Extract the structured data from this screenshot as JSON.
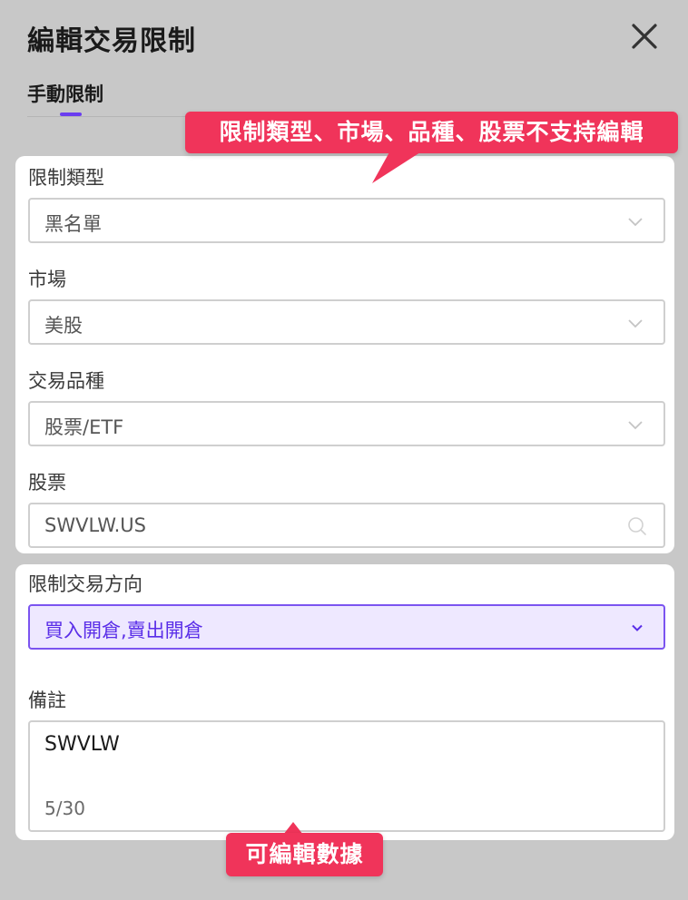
{
  "dialog": {
    "title": "編輯交易限制",
    "close_icon": "close-icon"
  },
  "tabs": [
    {
      "label": "手動限制",
      "active": true
    }
  ],
  "form": {
    "restriction_type": {
      "label": "限制類型",
      "value": "黑名單"
    },
    "market": {
      "label": "市場",
      "value": "美股"
    },
    "product_type": {
      "label": "交易品種",
      "value": "股票/ETF"
    },
    "stock": {
      "label": "股票",
      "value": "SWVLW.US"
    },
    "direction": {
      "label": "限制交易方向",
      "value": "買入開倉,賣出開倉"
    },
    "remark": {
      "label": "備註",
      "value": "SWVLW",
      "counter": "5/30"
    }
  },
  "annotations": {
    "not_editable": "限制類型、市場、品種、股票不支持編輯",
    "editable": "可編輯數據"
  },
  "colors": {
    "accent": "#6a3df0",
    "callout": "#f0345a",
    "active_bg": "#eee8ff",
    "overlay": "#c8c8c8"
  }
}
